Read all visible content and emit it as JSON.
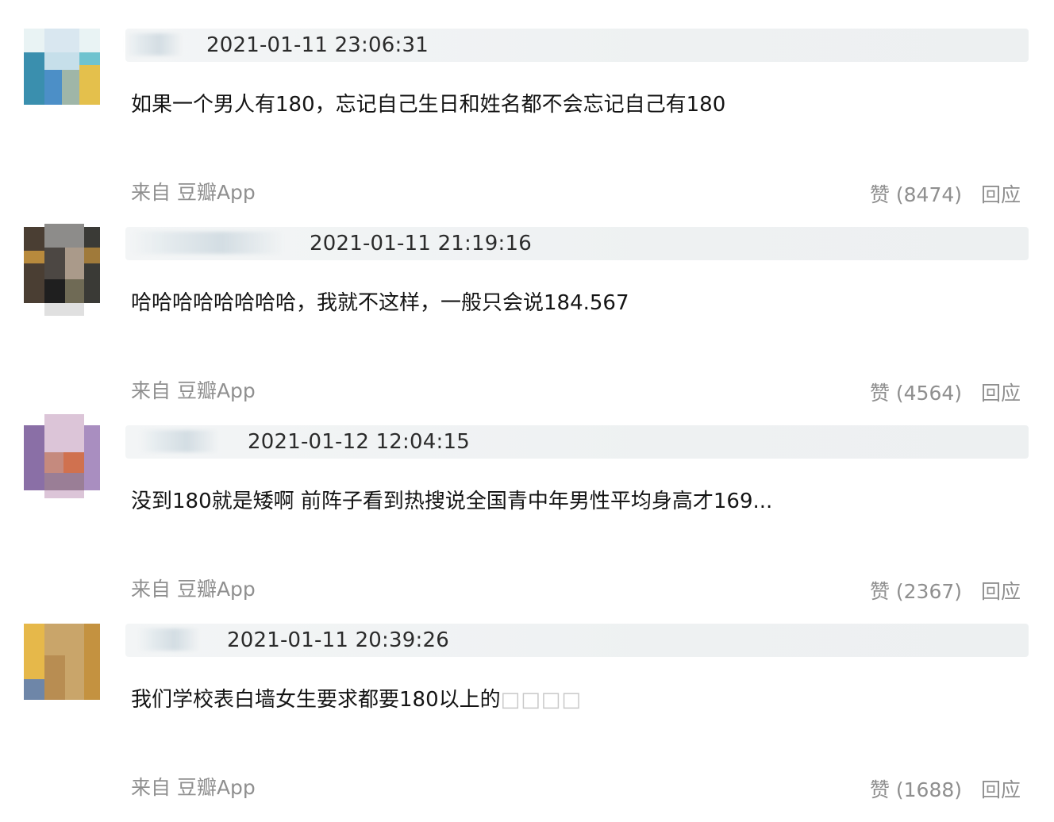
{
  "comments": [
    {
      "time": "2021-01-11 23:06:31",
      "text": "如果一个男人有180，忘记自己生日和姓名都不会忘记自己有180",
      "boxes": "",
      "source": "来自 豆瓣App",
      "like_label": "赞 (8474)",
      "reply_label": "回应"
    },
    {
      "time": "2021-01-11 21:19:16",
      "text": "哈哈哈哈哈哈哈哈，我就不这样，一般只会说184.567",
      "boxes": "",
      "source": "来自 豆瓣App",
      "like_label": "赞 (4564)",
      "reply_label": "回应"
    },
    {
      "time": "2021-01-12 12:04:15",
      "text": "没到180就是矮啊 前阵子看到热搜说全国青中年男性平均身高才169...",
      "boxes": "",
      "source": "来自 豆瓣App",
      "like_label": "赞 (2367)",
      "reply_label": "回应"
    },
    {
      "time": "2021-01-11 20:39:26",
      "text": "我们学校表白墙女生要求都要180以上的",
      "boxes": "□□□□",
      "source": "来自 豆瓣App",
      "like_label": "赞 (1688)",
      "reply_label": "回应"
    }
  ],
  "colors": {
    "meta_bar": "#eef1f2",
    "secondary_text": "#8f8f8f",
    "primary_text": "#141414"
  }
}
